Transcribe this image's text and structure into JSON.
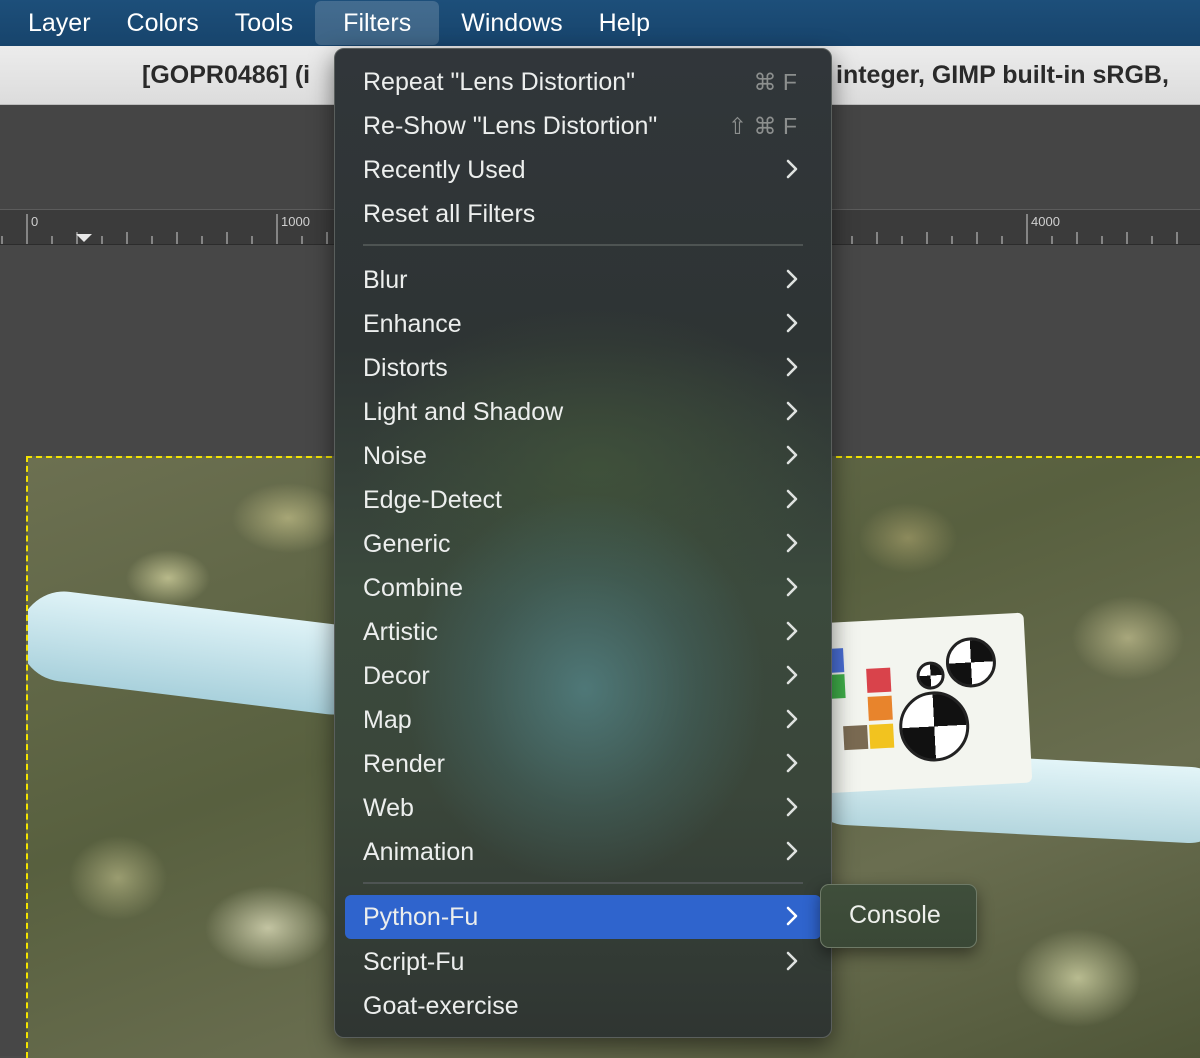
{
  "menubar": {
    "items": [
      "Layer",
      "Colors",
      "Tools",
      "Filters",
      "Windows",
      "Help"
    ],
    "active": "Filters"
  },
  "titlebar": {
    "left_text": "[GOPR0486] (i",
    "right_text": "integer, GIMP built-in sRGB,"
  },
  "ruler": {
    "labels": [
      "0",
      "1000",
      "4000"
    ]
  },
  "filters_menu": {
    "group1": [
      {
        "label": "Repeat \"Lens Distortion\"",
        "shortcut": "⌘ F"
      },
      {
        "label": "Re-Show \"Lens Distortion\"",
        "shortcut": "⇧ ⌘ F"
      },
      {
        "label": "Recently Used",
        "submenu": true
      },
      {
        "label": "Reset all Filters"
      }
    ],
    "group2": [
      {
        "label": "Blur"
      },
      {
        "label": "Enhance"
      },
      {
        "label": "Distorts"
      },
      {
        "label": "Light and Shadow"
      },
      {
        "label": "Noise"
      },
      {
        "label": "Edge-Detect"
      },
      {
        "label": "Generic"
      },
      {
        "label": "Combine"
      },
      {
        "label": "Artistic"
      },
      {
        "label": "Decor"
      },
      {
        "label": "Map"
      },
      {
        "label": "Render"
      },
      {
        "label": "Web"
      },
      {
        "label": "Animation"
      }
    ],
    "group3": [
      {
        "label": "Python-Fu",
        "selected": true
      },
      {
        "label": "Script-Fu"
      },
      {
        "label": "Goat-exercise"
      }
    ]
  },
  "python_fu_submenu": {
    "items": [
      "Console"
    ]
  },
  "colors": {
    "menubar_bg": "#17446c",
    "selection": "#2f64cd",
    "canvas_border": "#f5e400"
  }
}
